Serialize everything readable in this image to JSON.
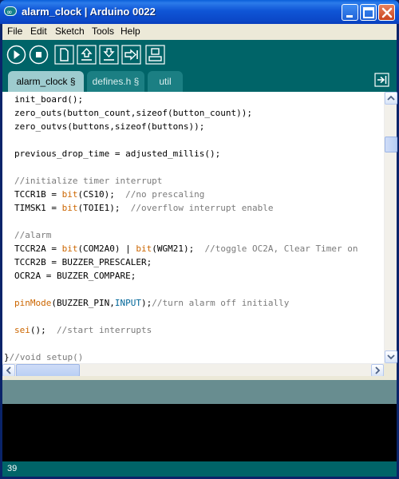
{
  "window": {
    "title": "alarm_clock | Arduino 0022",
    "controls": [
      "minimize",
      "maximize",
      "close"
    ]
  },
  "menu": [
    "File",
    "Edit",
    "Sketch",
    "Tools",
    "Help"
  ],
  "toolbar": {
    "buttons": [
      "verify-icon",
      "stop-icon",
      "new-icon",
      "open-icon",
      "save-icon",
      "upload-icon",
      "serial-monitor-icon"
    ]
  },
  "tabs": [
    {
      "label": "alarm_clock §",
      "active": true
    },
    {
      "label": "defines.h §",
      "active": false
    },
    {
      "label": "util",
      "active": false
    }
  ],
  "editor": {
    "lines": [
      "init_board();",
      "zero_outs(button_count,sizeof(button_count));",
      "zero_outvs(buttons,sizeof(buttons));",
      "",
      "previous_drop_time = adjusted_millis();",
      "",
      "//initialize timer interrupt",
      "TCCR1B = bit(CS10);  //no prescaling",
      "TIMSK1 = bit(TOIE1);  //overflow interrupt enable",
      "",
      "//alarm",
      "TCCR2A = bit(COM2A0) | bit(WGM21);  //toggle OC2A, Clear Timer on",
      "TCCR2B = BUZZER_PRESCALER;",
      "OCR2A = BUZZER_COMPARE;",
      "",
      "pinMode(BUZZER_PIN,INPUT);//turn alarm off initially",
      "",
      "sei();  //start interrupts",
      "",
      "}//void setup()"
    ]
  },
  "status": {
    "line_number": "39"
  },
  "colors": {
    "toolbar_bg": "#006468",
    "active_tab": "#9ecccf",
    "inactive_tab": "#1b7f83",
    "status_bg": "#688d90",
    "console_bg": "#000000",
    "comment": "#7a7a7a",
    "keyword": "#cc6600",
    "constant": "#006699"
  }
}
